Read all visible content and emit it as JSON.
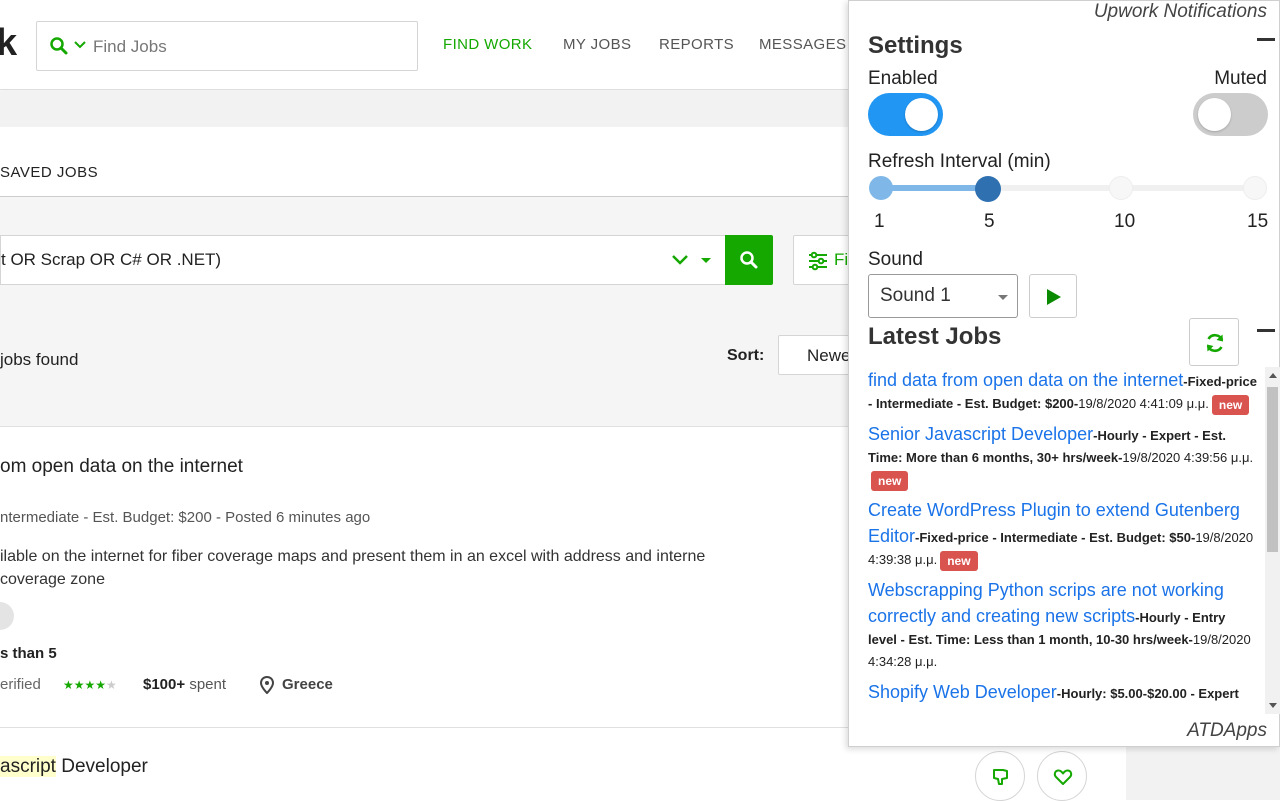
{
  "header": {
    "logo_fragment": "k",
    "search_placeholder": "Find Jobs",
    "nav": [
      "FIND WORK",
      "MY JOBS",
      "REPORTS",
      "MESSAGES"
    ]
  },
  "page": {
    "saved_jobs_tab": "SAVED JOBS",
    "query_text": "t OR Scrap OR C# OR .NET)",
    "filters_label": "Fi",
    "jobs_found": "jobs found",
    "sort_label": "Sort:",
    "sort_value": "Newe",
    "job1": {
      "title": "om open data on the internet",
      "meta": "ntermediate - Est. Budget: $200 - Posted 6 minutes ago",
      "desc_line1": "ilable on the internet for fiber coverage maps and present them in an excel with address and interne",
      "desc_line2": "coverage zone",
      "proposals": "s than 5",
      "verified": "erified",
      "rating": 4,
      "spent_amount": "$100+",
      "spent_suffix": "spent",
      "country": "Greece"
    },
    "job2": {
      "title_highlight": "ascript",
      "title_rest": " Developer"
    }
  },
  "popup": {
    "title": "Upwork Notifications",
    "settings_heading": "Settings",
    "enabled_label": "Enabled",
    "enabled": true,
    "muted_label": "Muted",
    "muted": false,
    "refresh_label": "Refresh Interval (min)",
    "refresh_ticks": [
      "1",
      "5",
      "10",
      "15"
    ],
    "refresh_value": 5,
    "sound_label": "Sound",
    "sound_value": "Sound 1",
    "latest_heading": "Latest Jobs",
    "jobs": [
      {
        "title": "find data from open data on the internet",
        "details": "-Fixed-price - Intermediate - Est. Budget: $200-",
        "date": "19/8/2020 4:41:09 μ.μ.",
        "new": "new"
      },
      {
        "title": "Senior Javascript Developer",
        "details": "-Hourly - Expert - Est. Time: More than 6 months, 30+ hrs/week-",
        "date": "19/8/2020 4:39:56 μ.μ.",
        "new": "new"
      },
      {
        "title": "Create WordPress Plugin to extend Gutenberg Editor",
        "details": "-Fixed-price - Intermediate - Est. Budget: $50-",
        "date": "19/8/2020 4:39:38 μ.μ.",
        "new": "new"
      },
      {
        "title": "Webscrapping Python scrips are not working correctly and creating new scripts",
        "details": "-Hourly - Entry level - Est. Time: Less than 1 month, 10-30 hrs/week-",
        "date": "19/8/2020 4:34:28 μ.μ.",
        "new": ""
      },
      {
        "title": "Shopify Web Developer",
        "details": "-Hourly: $5.00-$20.00 - Expert",
        "date": "",
        "new": ""
      }
    ],
    "footer": "ATDApps"
  },
  "colors": {
    "brand_green": "#14a800",
    "toggle_on": "#2196f3",
    "link_blue": "#1a73e8",
    "badge_red": "#d9534f"
  }
}
